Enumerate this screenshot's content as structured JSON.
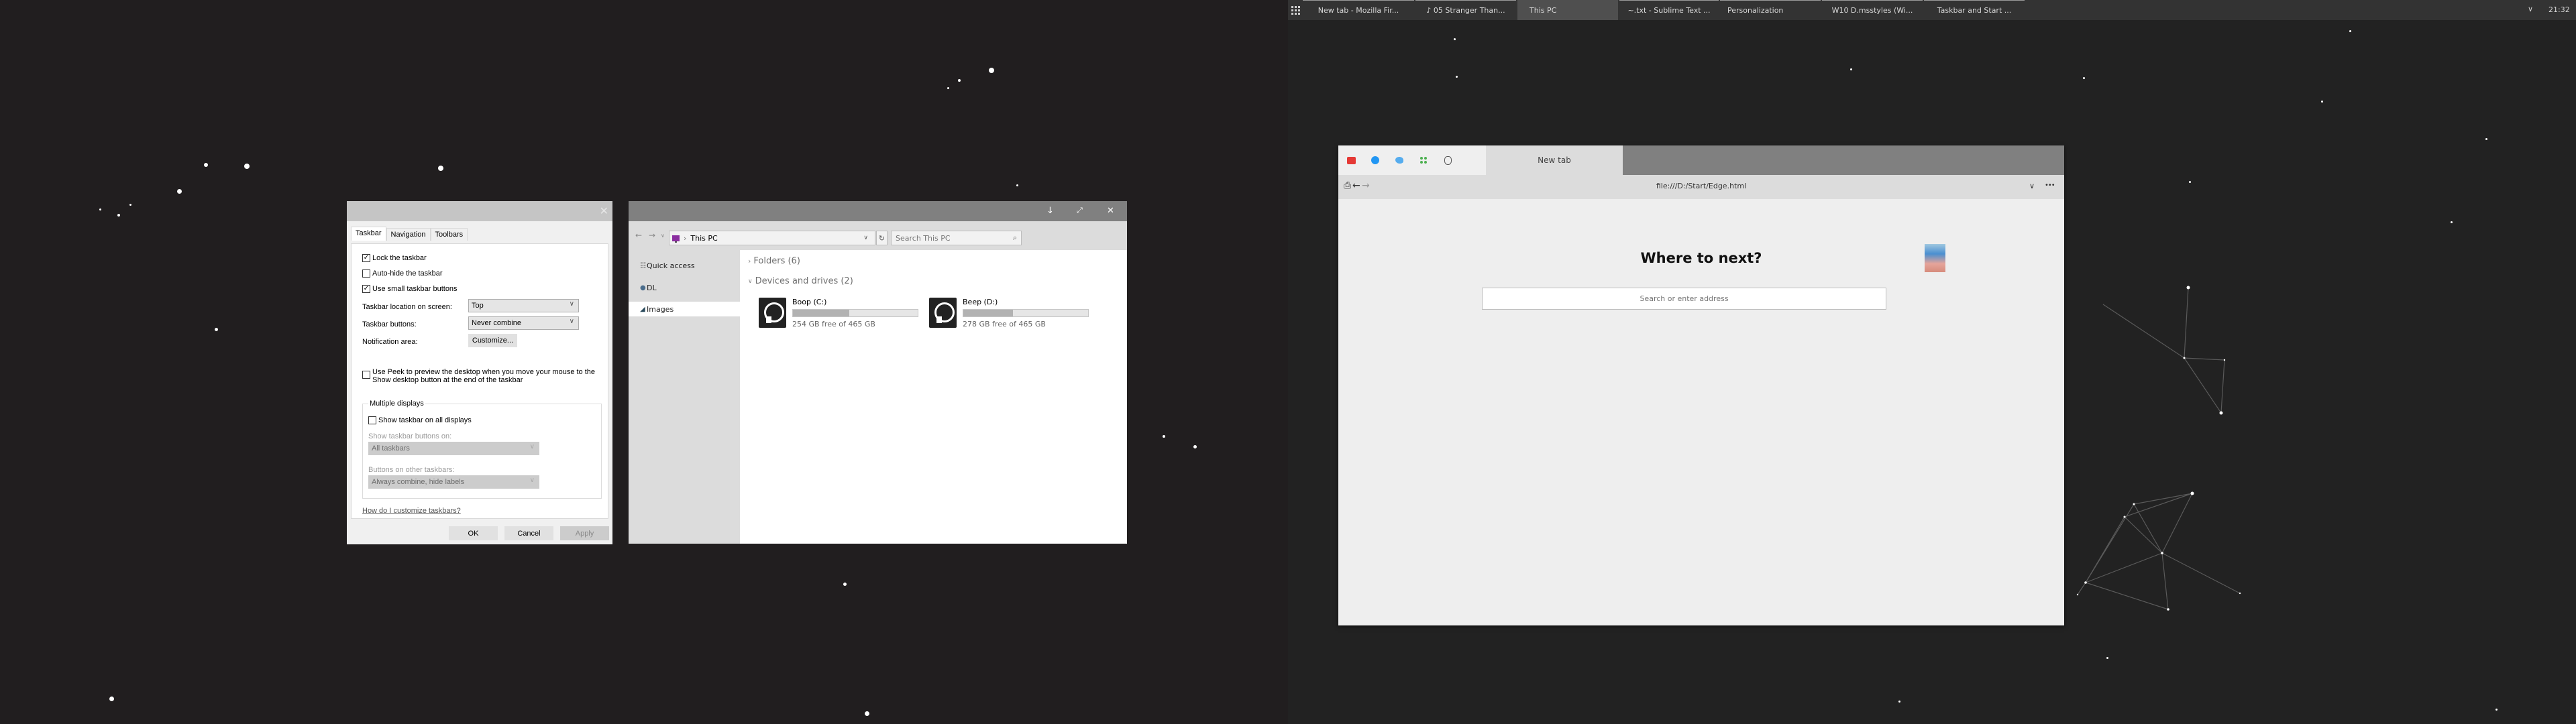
{
  "taskbar": {
    "start_icon": "app-grid-icon",
    "tasks": [
      {
        "label": "New tab - Mozilla Fir...",
        "active": false
      },
      {
        "label": "♪ 05 Stranger Than...",
        "active": false
      },
      {
        "label": "This PC",
        "active": true
      },
      {
        "label": "~.txt - Sublime Text ...",
        "active": false
      },
      {
        "label": "Personalization",
        "active": false
      },
      {
        "label": "W10 D.msstyles (Wi...",
        "active": false
      },
      {
        "label": "Taskbar and Start ...",
        "active": false
      }
    ],
    "tray_chevron": "∨",
    "clock": "21:32"
  },
  "taskbar_dialog": {
    "close_glyph": "✕",
    "tabs": [
      "Taskbar",
      "Navigation",
      "Toolbars"
    ],
    "active_tab": "Taskbar",
    "checkboxes": [
      {
        "label": "Lock the taskbar",
        "checked": true,
        "mark": "✓"
      },
      {
        "label": "Auto-hide the taskbar",
        "checked": false,
        "mark": ""
      },
      {
        "label": "Use small taskbar buttons",
        "checked": true,
        "mark": "✓"
      }
    ],
    "location_label": "Taskbar location on screen:",
    "location_value": "Top",
    "buttons_label": "Taskbar buttons:",
    "buttons_value": "Never combine",
    "notification_label": "Notification area:",
    "customize_button": "Customize...",
    "peek_label_line1": "Use Peek to preview the desktop when you move your mouse to the",
    "peek_label_line2": "Show desktop button at the end of the taskbar",
    "peek_checked": false,
    "multi_display": {
      "legend": "Multiple displays",
      "show_all_label": "Show taskbar on all displays",
      "show_all_checked": false,
      "show_buttons_on_label": "Show taskbar buttons on:",
      "show_buttons_on_value": "All taskbars",
      "other_taskbars_label": "Buttons on other taskbars:",
      "other_taskbars_value": "Always combine, hide labels"
    },
    "help_link": "How do I customize taskbars?",
    "ok": "OK",
    "cancel": "Cancel",
    "apply": "Apply",
    "chevron": "∨"
  },
  "explorer": {
    "controls": {
      "minimize": "↓",
      "maximize": "⤢",
      "close": "✕"
    },
    "nav": {
      "back": "←",
      "forward": "→",
      "recent": "∨",
      "refresh": "↻"
    },
    "breadcrumb_sep": "›",
    "address": "This PC",
    "search_placeholder": "Search This PC",
    "search_icon": "⌕",
    "sidebar": [
      {
        "label": "Quick access",
        "icon": "☷",
        "active": false
      },
      {
        "label": "DL",
        "icon": "●",
        "active": false
      },
      {
        "label": "Images",
        "icon": "◢",
        "active": true
      }
    ],
    "folders_header": "Folders (6)",
    "folders_chevron": "›",
    "devices_header": "Devices and drives (2)",
    "devices_chevron": "∨",
    "drives": [
      {
        "name": "Boop (C:)",
        "free": "254 GB free of 465 GB",
        "used_fraction": 0.45
      },
      {
        "name": "Beep (D:)",
        "free": "278 GB free of 465 GB",
        "used_fraction": 0.4
      }
    ]
  },
  "browser": {
    "pinned": [
      {
        "name": "youtube",
        "color": "#e53935"
      },
      {
        "name": "messenger",
        "color": "#2196f3"
      },
      {
        "name": "twitter",
        "color": "#55acee"
      },
      {
        "name": "apps",
        "color": "#4caf50"
      },
      {
        "name": "bag",
        "color": "#555555"
      }
    ],
    "tab_label": "New tab",
    "url": "file:///D:/Start/Edge.html",
    "heading": "Where to next?",
    "search_placeholder": "Search or enter address",
    "icons": {
      "bookmark": "⎙",
      "back": "←",
      "forward": "→",
      "dropdown": "∨",
      "more": "•••"
    }
  }
}
